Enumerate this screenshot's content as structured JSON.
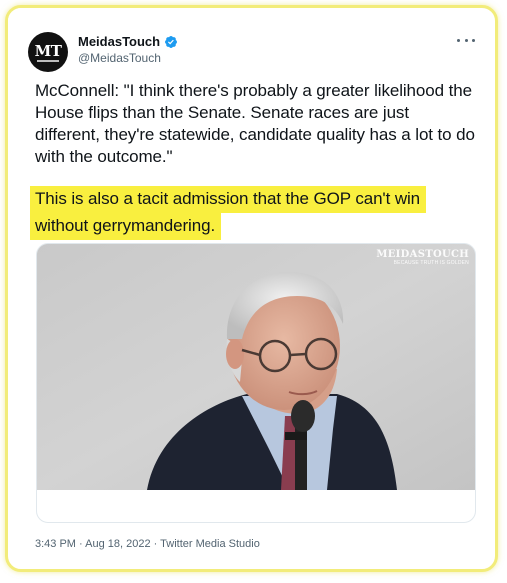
{
  "account": {
    "avatar_text": "MT",
    "display_name": "MeidasTouch",
    "handle": "@MeidasTouch",
    "verified": true
  },
  "tweet": {
    "text": "McConnell: \"I think there's probably a greater likelihood the House flips than the Senate. Senate races are just different, they're statewide, candidate quality has a lot to do with the outcome.\"",
    "highlight_lines": [
      "This is also a tacit admission that the GOP can't win",
      "without gerrymandering."
    ]
  },
  "media": {
    "type": "video",
    "watermark_brand": "MEIDASTOUCH",
    "watermark_tagline": "BECAUSE TRUTH IS GOLDEN"
  },
  "meta": {
    "text": "3:43 PM · Aug 18, 2022 · Twitter Media Studio"
  },
  "colors": {
    "highlight": "#f9ef3f",
    "frame": "#f2ec7a",
    "verified": "#1d9bf0",
    "secondary_text": "#536471"
  },
  "icons": [
    "verified-badge-icon",
    "more-options-icon"
  ]
}
